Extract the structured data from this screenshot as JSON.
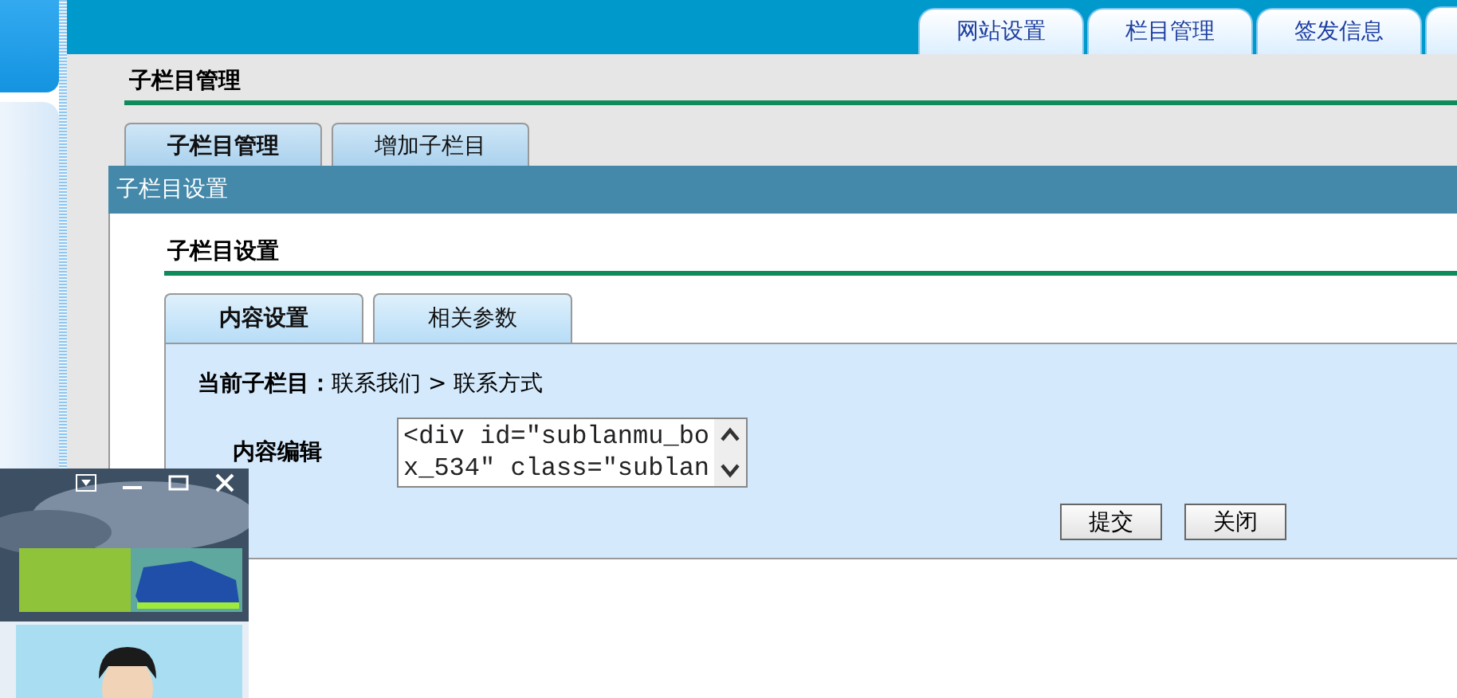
{
  "top_tabs": [
    {
      "label": "网站设置"
    },
    {
      "label": "栏目管理"
    },
    {
      "label": "签发信息"
    }
  ],
  "page": {
    "title": "子栏目管理",
    "tabs": [
      {
        "label": "子栏目管理",
        "selected": true
      },
      {
        "label": "增加子栏目",
        "selected": false
      }
    ]
  },
  "dialog": {
    "title": "子栏目设置",
    "heading": "子栏目设置",
    "tabs": [
      {
        "label": "内容设置",
        "selected": true
      },
      {
        "label": "相关参数",
        "selected": false
      }
    ],
    "breadcrumb": {
      "label": "当前子栏目：",
      "path": "联系我们 > 联系方式"
    },
    "field": {
      "label": "内容编辑",
      "value": "<div id=\"sublanmu_box_534\" class=\"sublan"
    },
    "buttons": [
      "提交",
      "关闭"
    ]
  }
}
